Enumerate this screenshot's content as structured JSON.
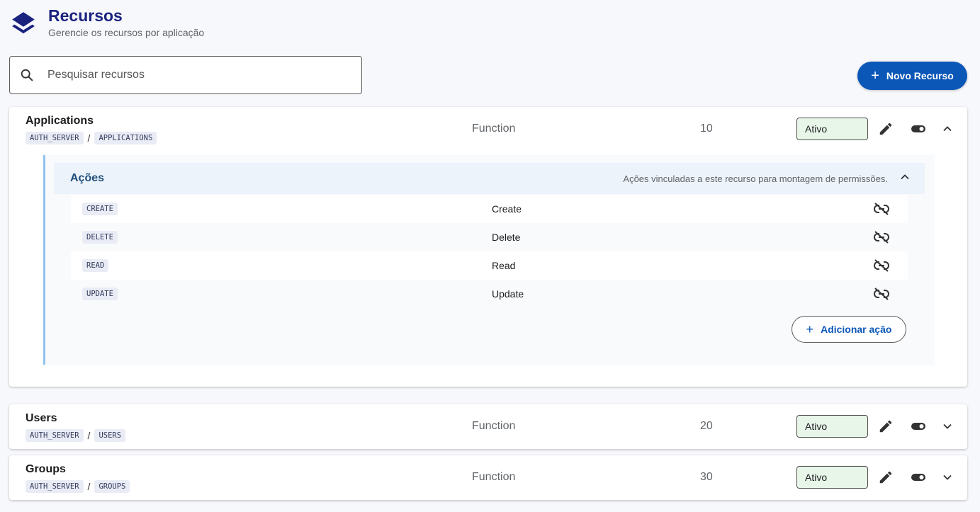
{
  "header": {
    "title": "Recursos",
    "subtitle": "Gerencie os recursos por aplicação"
  },
  "search": {
    "placeholder": "Pesquisar recursos",
    "value": ""
  },
  "new_button": {
    "label": "Novo Recurso"
  },
  "resources": [
    {
      "name": "Applications",
      "path": [
        "AUTH_SERVER",
        "APPLICATIONS"
      ],
      "path_separator": "/",
      "type": "Function",
      "order": "10",
      "status": "Ativo",
      "expanded": true,
      "actions_section": {
        "title": "Ações",
        "description": "Ações vinculadas a este recurso para montagem de permissões.",
        "items": [
          {
            "code": "CREATE",
            "label": "Create"
          },
          {
            "code": "DELETE",
            "label": "Delete"
          },
          {
            "code": "READ",
            "label": "Read"
          },
          {
            "code": "UPDATE",
            "label": "Update"
          }
        ],
        "add_label": "Adicionar ação"
      }
    },
    {
      "name": "Users",
      "path": [
        "AUTH_SERVER",
        "USERS"
      ],
      "path_separator": "/",
      "type": "Function",
      "order": "20",
      "status": "Ativo",
      "expanded": false
    },
    {
      "name": "Groups",
      "path": [
        "AUTH_SERVER",
        "GROUPS"
      ],
      "path_separator": "/",
      "type": "Function",
      "order": "30",
      "status": "Ativo",
      "expanded": false
    }
  ],
  "icons": {
    "logo": "layers-icon",
    "search": "search-icon",
    "edit": "pencil-icon",
    "toggle": "toggle-icon",
    "expand": "chevron-icon",
    "unlink": "link-off-icon",
    "add": "plus-icon"
  },
  "colors": {
    "primary": "#0b57b8",
    "title": "#1a237e",
    "status_bg": "#e8f5e9",
    "accent_border": "#90c2ee"
  }
}
